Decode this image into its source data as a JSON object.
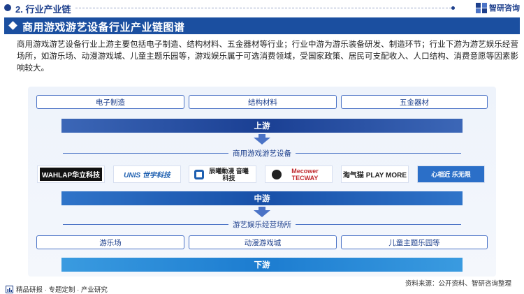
{
  "section": {
    "title": "2. 行业产业链",
    "logo_text": "智研咨询"
  },
  "banner": {
    "title": "商用游戏游艺设备行业产业链图谱"
  },
  "description": "商用游戏游艺设备行业上游主要包括电子制造、结构材料、五金器材等行业；行业中游为游乐装备研发、制造环节；行业下游为游艺娱乐经营场所，如游乐场、动漫游戏城、儿童主题乐园等，游戏娱乐属于可选消费领域，受国家政策、居民可支配收入、人口结构、消费意愿等因素影响较大。",
  "upstream": {
    "items": [
      "电子制造",
      "结构材料",
      "五金器材"
    ],
    "stage_label": "上游"
  },
  "midstream": {
    "category_label": "商用游戏游艺设备",
    "companies": [
      {
        "name": "WAHLAP华立科技",
        "icon": "wahlap-logo",
        "color": "#111111"
      },
      {
        "name": "UNIS 世宇科技",
        "icon": "unis-logo",
        "color": "#1d5fb0"
      },
      {
        "name": "辰曦動漫 音曦科技",
        "icon": "chenxi-logo",
        "color": "#222222"
      },
      {
        "name": "Mecower TECWAY",
        "icon": "mecower-logo",
        "color": "#c0282d"
      },
      {
        "name": "淘气猫 PLAY MORE",
        "icon": "playmore-logo",
        "color": "#222222"
      },
      {
        "name": "心相近 乐无限",
        "icon": "leisure-logo",
        "color": "#2b6fc8"
      }
    ],
    "stage_label": "中游"
  },
  "downstream": {
    "category_label": "游艺娱乐经营场所",
    "items": [
      "游乐场",
      "动漫游戏城",
      "儿童主题乐园等"
    ],
    "stage_label": "下游"
  },
  "footer": {
    "left_text": "精品研报 · 专题定制 · 产业研究",
    "source": "资料来源：公开资料、智研咨询整理"
  },
  "colors": {
    "brand_dark": "#1d3f8c",
    "banner": "#1b4fa0",
    "border": "#4b73c6"
  }
}
